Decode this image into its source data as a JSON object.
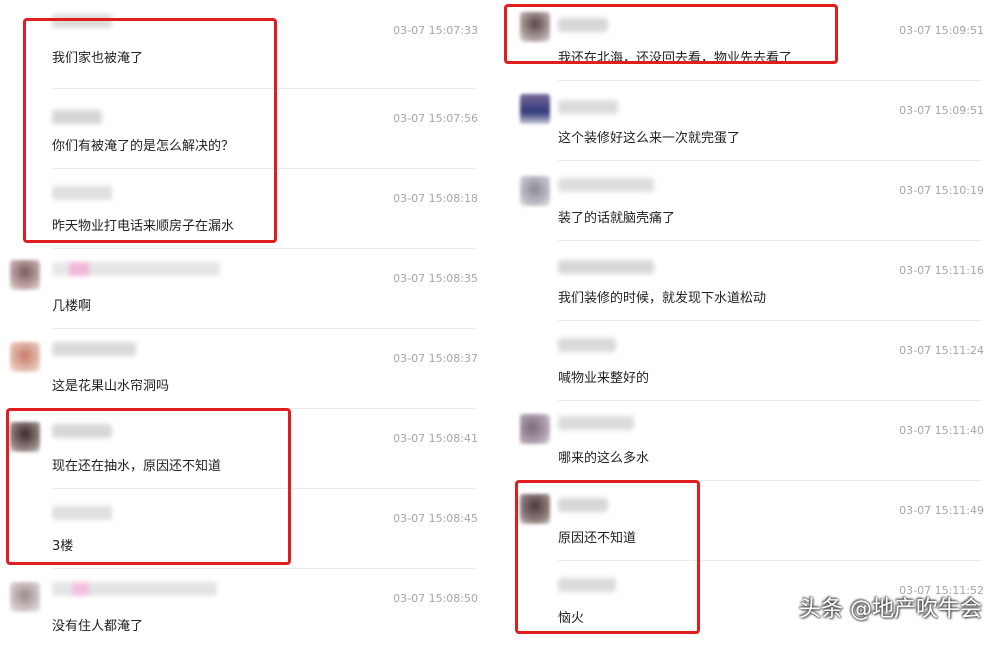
{
  "left_messages": [
    {
      "timestamp": "03-07 15:07:33",
      "text": "我们家也被淹了"
    },
    {
      "timestamp": "03-07 15:07:56",
      "text": "你们有被淹了的是怎么解决的？"
    },
    {
      "timestamp": "03-07 15:08:18",
      "text": "昨天物业打电话来顺房子在漏水"
    },
    {
      "timestamp": "03-07 15:08:35",
      "text": "几楼啊"
    },
    {
      "timestamp": "03-07 15:08:37",
      "text": "这是花果山水帘洞吗"
    },
    {
      "timestamp": "03-07 15:08:41",
      "text": "现在还在抽水，原因还不知道"
    },
    {
      "timestamp": "03-07 15:08:45",
      "text": "3楼"
    },
    {
      "timestamp": "03-07 15:08:50",
      "text": "没有住人都淹了"
    }
  ],
  "right_messages": [
    {
      "timestamp": "03-07 15:09:51",
      "text": "我还在北海，还没回去看，物业先去看了"
    },
    {
      "timestamp": "03-07 15:09:51",
      "text": "这个装修好这么来一次就完蛋了"
    },
    {
      "timestamp": "03-07 15:10:19",
      "text": "装了的话就脑壳痛了"
    },
    {
      "timestamp": "03-07 15:11:16",
      "text": "我们装修的时候，就发现下水道松动"
    },
    {
      "timestamp": "03-07 15:11:24",
      "text": "喊物业来整好的"
    },
    {
      "timestamp": "03-07 15:11:40",
      "text": "哪来的这么多水"
    },
    {
      "timestamp": "03-07 15:11:49",
      "text": "原因还不知道"
    },
    {
      "timestamp": "03-07 15:11:52",
      "text": "恼火"
    }
  ],
  "watermark": "头条 @地产吹牛会",
  "colors": {
    "highlight": "#e21d1d",
    "timestamp": "#a6a6a6",
    "text": "#222222"
  }
}
